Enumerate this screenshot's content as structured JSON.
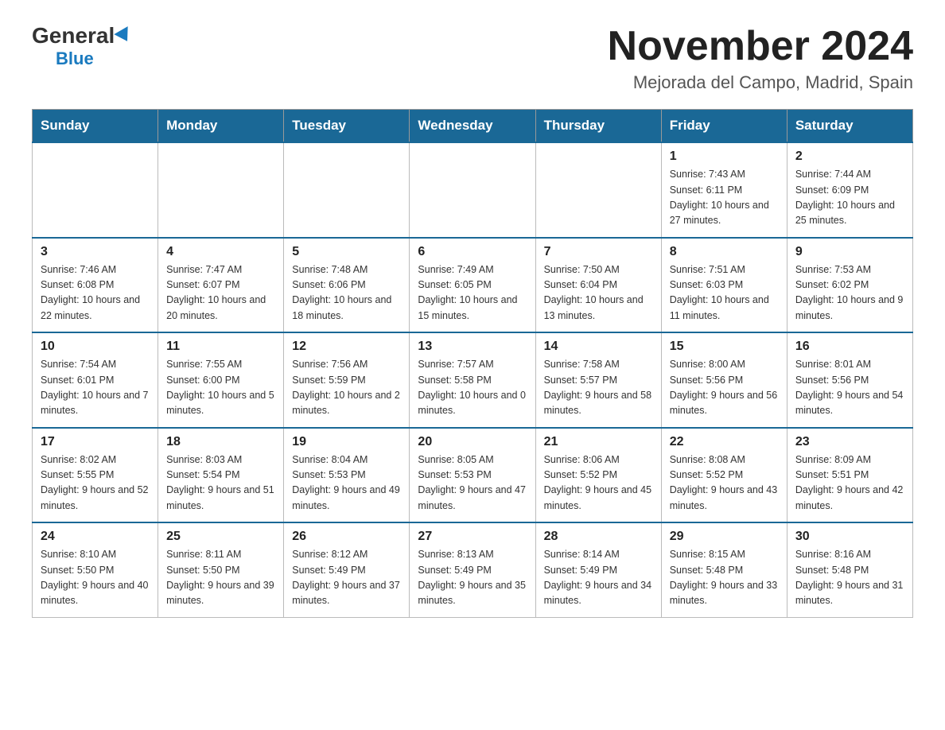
{
  "header": {
    "logo_general": "General",
    "logo_blue": "Blue",
    "month_title": "November 2024",
    "location": "Mejorada del Campo, Madrid, Spain"
  },
  "weekdays": [
    "Sunday",
    "Monday",
    "Tuesday",
    "Wednesday",
    "Thursday",
    "Friday",
    "Saturday"
  ],
  "weeks": [
    [
      {
        "day": "",
        "sunrise": "",
        "sunset": "",
        "daylight": ""
      },
      {
        "day": "",
        "sunrise": "",
        "sunset": "",
        "daylight": ""
      },
      {
        "day": "",
        "sunrise": "",
        "sunset": "",
        "daylight": ""
      },
      {
        "day": "",
        "sunrise": "",
        "sunset": "",
        "daylight": ""
      },
      {
        "day": "",
        "sunrise": "",
        "sunset": "",
        "daylight": ""
      },
      {
        "day": "1",
        "sunrise": "Sunrise: 7:43 AM",
        "sunset": "Sunset: 6:11 PM",
        "daylight": "Daylight: 10 hours and 27 minutes."
      },
      {
        "day": "2",
        "sunrise": "Sunrise: 7:44 AM",
        "sunset": "Sunset: 6:09 PM",
        "daylight": "Daylight: 10 hours and 25 minutes."
      }
    ],
    [
      {
        "day": "3",
        "sunrise": "Sunrise: 7:46 AM",
        "sunset": "Sunset: 6:08 PM",
        "daylight": "Daylight: 10 hours and 22 minutes."
      },
      {
        "day": "4",
        "sunrise": "Sunrise: 7:47 AM",
        "sunset": "Sunset: 6:07 PM",
        "daylight": "Daylight: 10 hours and 20 minutes."
      },
      {
        "day": "5",
        "sunrise": "Sunrise: 7:48 AM",
        "sunset": "Sunset: 6:06 PM",
        "daylight": "Daylight: 10 hours and 18 minutes."
      },
      {
        "day": "6",
        "sunrise": "Sunrise: 7:49 AM",
        "sunset": "Sunset: 6:05 PM",
        "daylight": "Daylight: 10 hours and 15 minutes."
      },
      {
        "day": "7",
        "sunrise": "Sunrise: 7:50 AM",
        "sunset": "Sunset: 6:04 PM",
        "daylight": "Daylight: 10 hours and 13 minutes."
      },
      {
        "day": "8",
        "sunrise": "Sunrise: 7:51 AM",
        "sunset": "Sunset: 6:03 PM",
        "daylight": "Daylight: 10 hours and 11 minutes."
      },
      {
        "day": "9",
        "sunrise": "Sunrise: 7:53 AM",
        "sunset": "Sunset: 6:02 PM",
        "daylight": "Daylight: 10 hours and 9 minutes."
      }
    ],
    [
      {
        "day": "10",
        "sunrise": "Sunrise: 7:54 AM",
        "sunset": "Sunset: 6:01 PM",
        "daylight": "Daylight: 10 hours and 7 minutes."
      },
      {
        "day": "11",
        "sunrise": "Sunrise: 7:55 AM",
        "sunset": "Sunset: 6:00 PM",
        "daylight": "Daylight: 10 hours and 5 minutes."
      },
      {
        "day": "12",
        "sunrise": "Sunrise: 7:56 AM",
        "sunset": "Sunset: 5:59 PM",
        "daylight": "Daylight: 10 hours and 2 minutes."
      },
      {
        "day": "13",
        "sunrise": "Sunrise: 7:57 AM",
        "sunset": "Sunset: 5:58 PM",
        "daylight": "Daylight: 10 hours and 0 minutes."
      },
      {
        "day": "14",
        "sunrise": "Sunrise: 7:58 AM",
        "sunset": "Sunset: 5:57 PM",
        "daylight": "Daylight: 9 hours and 58 minutes."
      },
      {
        "day": "15",
        "sunrise": "Sunrise: 8:00 AM",
        "sunset": "Sunset: 5:56 PM",
        "daylight": "Daylight: 9 hours and 56 minutes."
      },
      {
        "day": "16",
        "sunrise": "Sunrise: 8:01 AM",
        "sunset": "Sunset: 5:56 PM",
        "daylight": "Daylight: 9 hours and 54 minutes."
      }
    ],
    [
      {
        "day": "17",
        "sunrise": "Sunrise: 8:02 AM",
        "sunset": "Sunset: 5:55 PM",
        "daylight": "Daylight: 9 hours and 52 minutes."
      },
      {
        "day": "18",
        "sunrise": "Sunrise: 8:03 AM",
        "sunset": "Sunset: 5:54 PM",
        "daylight": "Daylight: 9 hours and 51 minutes."
      },
      {
        "day": "19",
        "sunrise": "Sunrise: 8:04 AM",
        "sunset": "Sunset: 5:53 PM",
        "daylight": "Daylight: 9 hours and 49 minutes."
      },
      {
        "day": "20",
        "sunrise": "Sunrise: 8:05 AM",
        "sunset": "Sunset: 5:53 PM",
        "daylight": "Daylight: 9 hours and 47 minutes."
      },
      {
        "day": "21",
        "sunrise": "Sunrise: 8:06 AM",
        "sunset": "Sunset: 5:52 PM",
        "daylight": "Daylight: 9 hours and 45 minutes."
      },
      {
        "day": "22",
        "sunrise": "Sunrise: 8:08 AM",
        "sunset": "Sunset: 5:52 PM",
        "daylight": "Daylight: 9 hours and 43 minutes."
      },
      {
        "day": "23",
        "sunrise": "Sunrise: 8:09 AM",
        "sunset": "Sunset: 5:51 PM",
        "daylight": "Daylight: 9 hours and 42 minutes."
      }
    ],
    [
      {
        "day": "24",
        "sunrise": "Sunrise: 8:10 AM",
        "sunset": "Sunset: 5:50 PM",
        "daylight": "Daylight: 9 hours and 40 minutes."
      },
      {
        "day": "25",
        "sunrise": "Sunrise: 8:11 AM",
        "sunset": "Sunset: 5:50 PM",
        "daylight": "Daylight: 9 hours and 39 minutes."
      },
      {
        "day": "26",
        "sunrise": "Sunrise: 8:12 AM",
        "sunset": "Sunset: 5:49 PM",
        "daylight": "Daylight: 9 hours and 37 minutes."
      },
      {
        "day": "27",
        "sunrise": "Sunrise: 8:13 AM",
        "sunset": "Sunset: 5:49 PM",
        "daylight": "Daylight: 9 hours and 35 minutes."
      },
      {
        "day": "28",
        "sunrise": "Sunrise: 8:14 AM",
        "sunset": "Sunset: 5:49 PM",
        "daylight": "Daylight: 9 hours and 34 minutes."
      },
      {
        "day": "29",
        "sunrise": "Sunrise: 8:15 AM",
        "sunset": "Sunset: 5:48 PM",
        "daylight": "Daylight: 9 hours and 33 minutes."
      },
      {
        "day": "30",
        "sunrise": "Sunrise: 8:16 AM",
        "sunset": "Sunset: 5:48 PM",
        "daylight": "Daylight: 9 hours and 31 minutes."
      }
    ]
  ]
}
